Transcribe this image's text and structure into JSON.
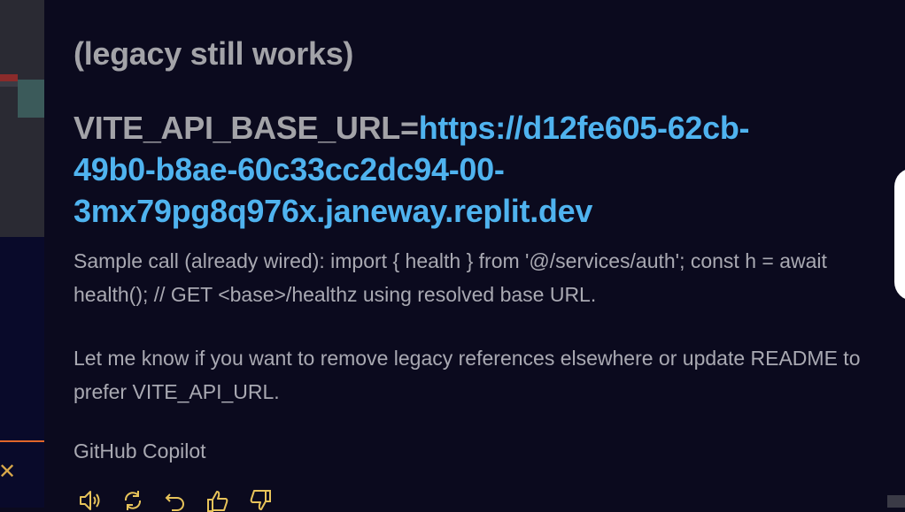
{
  "message": {
    "legacy_note": "(legacy still works)",
    "env_key": "VITE_API_BASE_URL=",
    "env_value_line1": "https://d12fe605-62cb-",
    "env_value_line2": "49b0-b8ae-60c33cc2dc94-00-",
    "env_value_line3": "3mx79pg8q976x.janeway.replit.dev",
    "sample_call": "Sample call (already wired): import { health } from '@/services/auth'; const h = await health(); // GET <base>/healthz using resolved base URL.",
    "followup": "Let me know if you want to remove legacy references elsewhere or update README to prefer VITE_API_URL.",
    "author": "GitHub Copilot"
  },
  "actions": [
    {
      "icon": "speaker-icon"
    },
    {
      "icon": "retry-icon"
    },
    {
      "icon": "undo-icon"
    },
    {
      "icon": "thumbs-up-icon"
    },
    {
      "icon": "thumbs-down-icon"
    }
  ],
  "colors": {
    "background": "#0b0a1e",
    "text_muted": "#a9a9b2",
    "link": "#4fb3ef",
    "accent_orange": "#e0662a"
  }
}
